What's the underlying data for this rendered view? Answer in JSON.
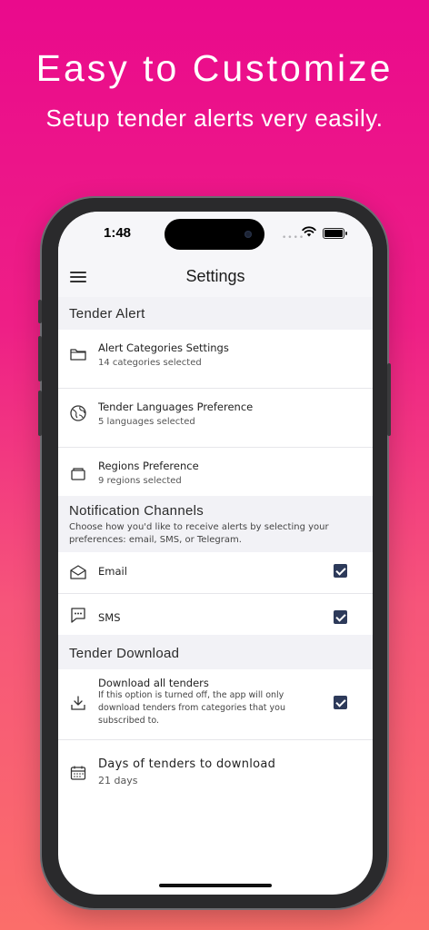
{
  "hero": {
    "title": "Easy to Customize",
    "subtitle": "Setup tender alerts very easily."
  },
  "status_bar": {
    "time": "1:48",
    "signal": "••••"
  },
  "app_bar": {
    "title": "Settings",
    "menu_icon": "hamburger-menu-icon"
  },
  "sections": {
    "tender_alert": {
      "heading": "Tender Alert",
      "items": [
        {
          "title": "Alert Categories Settings",
          "subtitle": "14 categories selected",
          "icon": "folder-icon"
        },
        {
          "title": "Tender Languages Preference",
          "subtitle": "5 languages selected",
          "icon": "globe-icon"
        },
        {
          "title": "Regions Preference",
          "subtitle": "9 regions selected",
          "icon": "tray-icon"
        }
      ]
    },
    "notification_channels": {
      "heading": "Notification Channels",
      "description": "Choose how you'd like to receive alerts by selecting your preferences: email, SMS, or Telegram.",
      "items": [
        {
          "title": "Email",
          "icon": "envelope-icon",
          "checked": true
        },
        {
          "title": "SMS",
          "icon": "message-icon",
          "checked": true
        }
      ]
    },
    "tender_download": {
      "heading": "Tender Download",
      "items": [
        {
          "title": "Download all tenders",
          "description": "If this option is turned off, the app will only download tenders from categories that you subscribed to.",
          "icon": "download-icon",
          "checked": true
        },
        {
          "title": "Days of tenders to download",
          "subtitle": "21 days",
          "icon": "calendar-icon"
        }
      ]
    }
  },
  "colors": {
    "background_top": "#ea0a8c",
    "background_bottom": "#fb6e6a",
    "checkbox": "#2d3a5a",
    "section_background": "#f2f2f6"
  }
}
